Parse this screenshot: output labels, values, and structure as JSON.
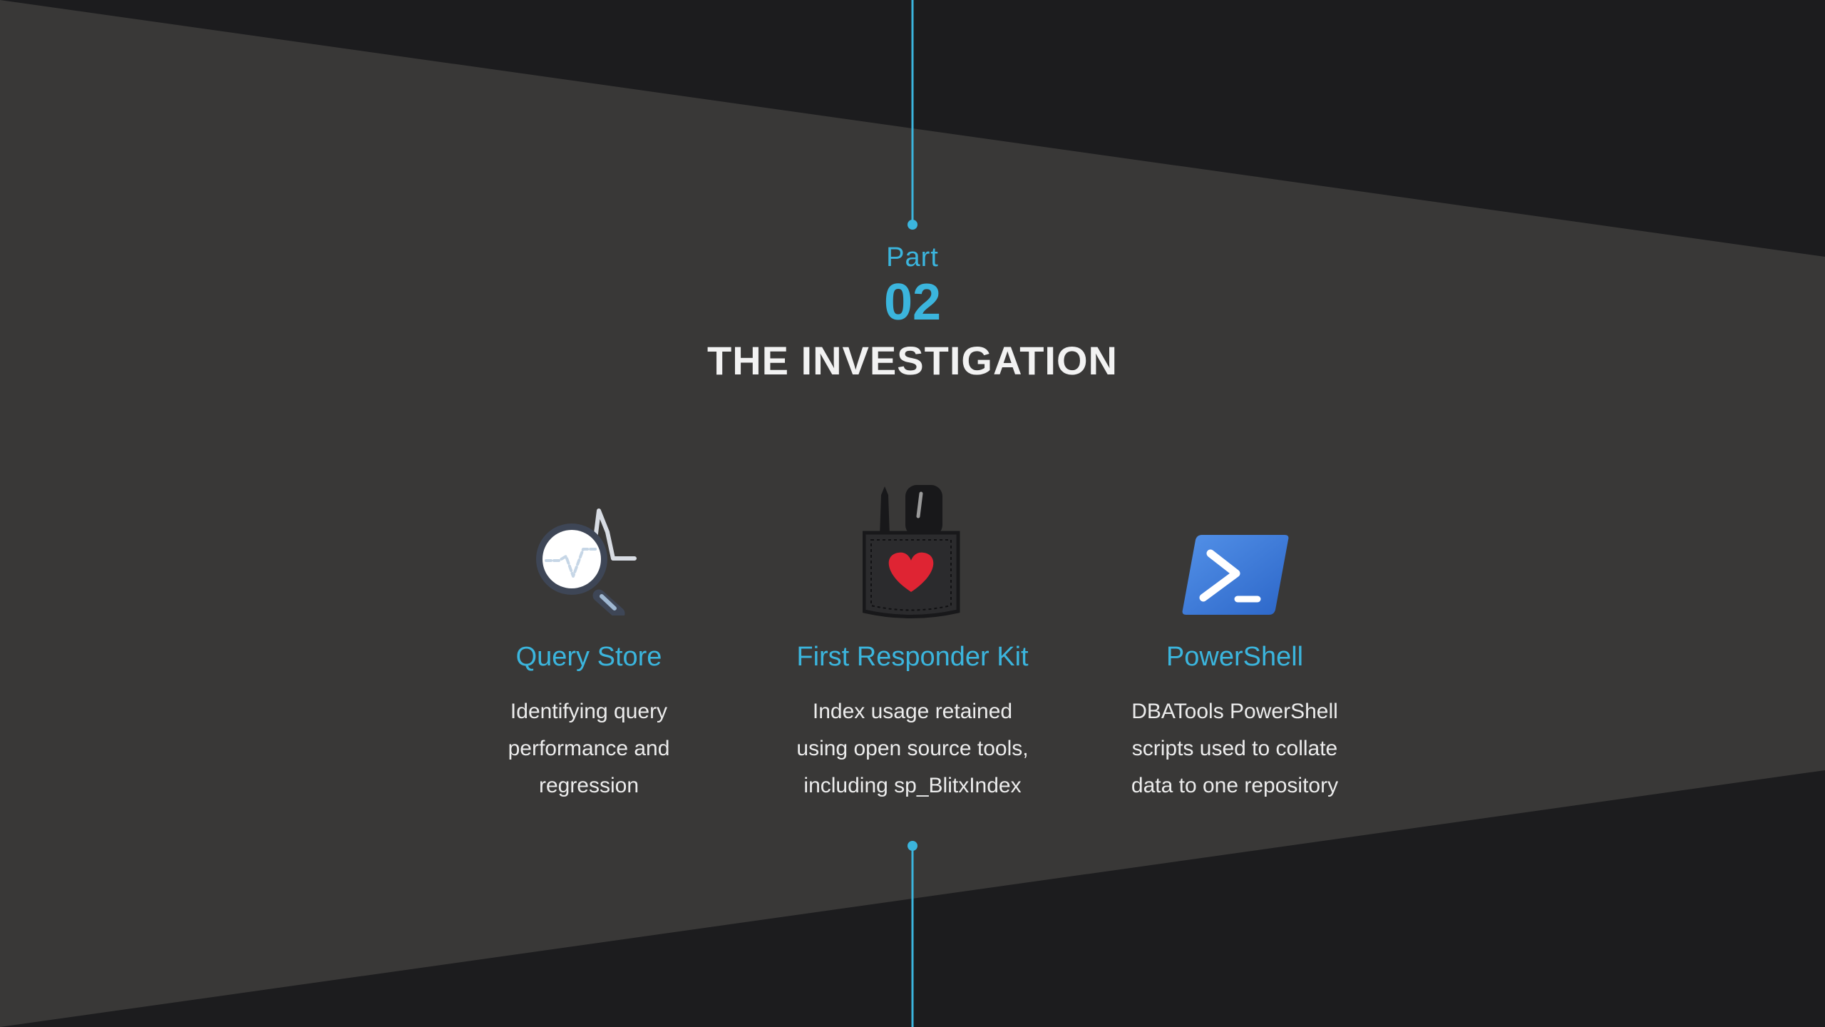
{
  "slide": {
    "part_label": "Part",
    "part_number": "02",
    "title": "THE INVESTIGATION"
  },
  "colors": {
    "background_dark": "#1c1c1e",
    "band": "#393837",
    "accent": "#3bb5dd",
    "text_light": "#f2f2f2"
  },
  "cards": [
    {
      "icon": "magnifier-chart-icon",
      "title": "Query Store",
      "description": "Identifying query performance and regression"
    },
    {
      "icon": "pocket-heart-icon",
      "title": "First Responder Kit",
      "description": "Index usage retained using open source tools, including sp_BlitxIndex"
    },
    {
      "icon": "powershell-icon",
      "title": "PowerShell",
      "description": "DBATools PowerShell scripts used to collate data to one repository"
    }
  ]
}
